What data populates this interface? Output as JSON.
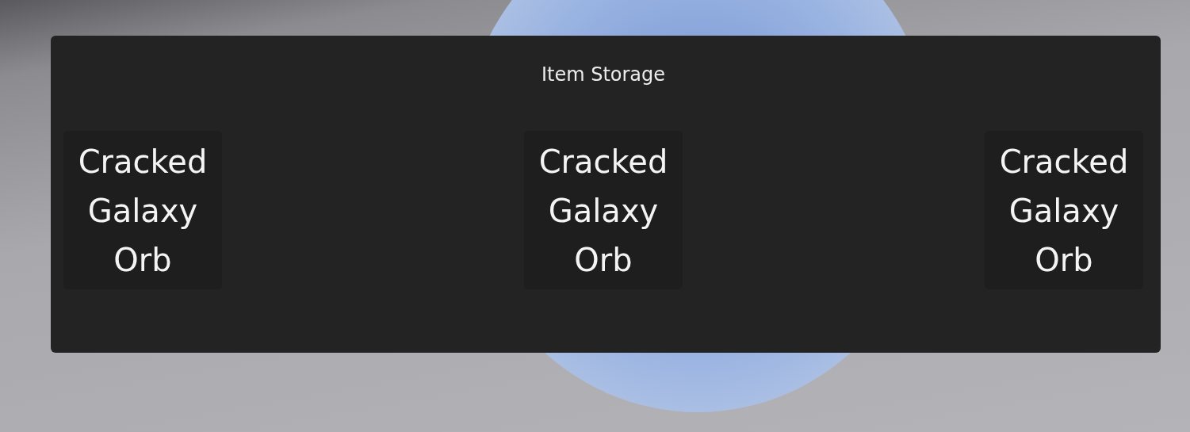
{
  "panel": {
    "title": "Item Storage"
  },
  "items": [
    {
      "name": "Cracked Galaxy Orb"
    },
    {
      "name": "Cracked Galaxy Orb"
    },
    {
      "name": "Cracked Galaxy Orb"
    }
  ]
}
